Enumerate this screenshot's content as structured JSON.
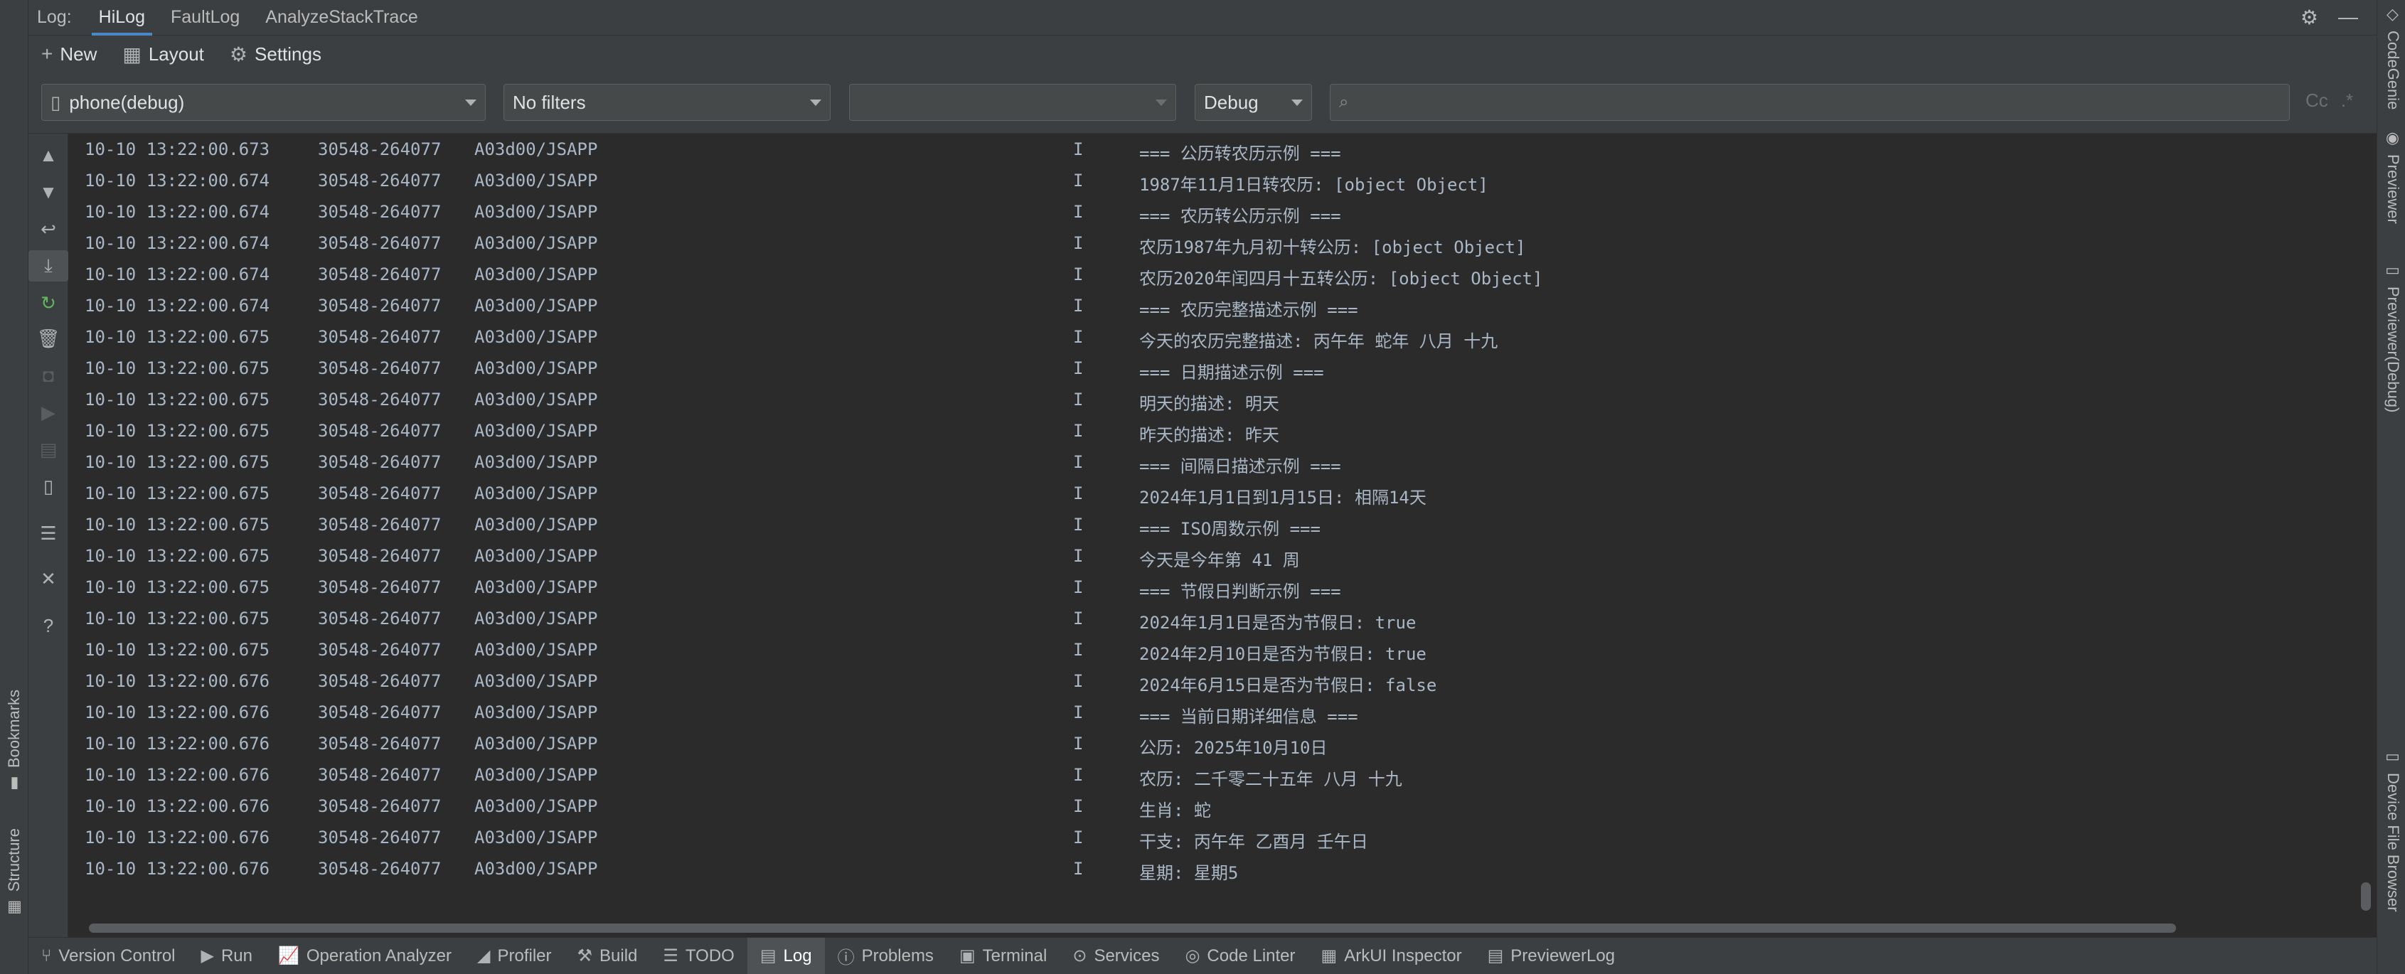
{
  "tabs": {
    "prefix": "Log:",
    "items": [
      "HiLog",
      "FaultLog",
      "AnalyzeStackTrace"
    ]
  },
  "toolbar": {
    "new_label": "New",
    "layout_label": "Layout",
    "settings_label": "Settings"
  },
  "filters": {
    "device": "phone(debug)",
    "filter": "No filters",
    "process": "",
    "level": "Debug",
    "search_value": "",
    "case_toggle": "Cc",
    "regex_toggle": ".*"
  },
  "right_stripe": [
    "CodeGenie",
    "Previewer",
    "Previewer(Debug)",
    "Device File Browser"
  ],
  "left_stripe": [
    "Bookmarks",
    "Structure"
  ],
  "log_rows": [
    {
      "time": "10-10 13:22:00.673",
      "pid": "30548-264077",
      "tag": "A03d00/JSAPP",
      "level": "I",
      "msg": "=== 公历转农历示例 ==="
    },
    {
      "time": "10-10 13:22:00.674",
      "pid": "30548-264077",
      "tag": "A03d00/JSAPP",
      "level": "I",
      "msg": "1987年11月1日转农历: [object Object]"
    },
    {
      "time": "10-10 13:22:00.674",
      "pid": "30548-264077",
      "tag": "A03d00/JSAPP",
      "level": "I",
      "msg": "=== 农历转公历示例 ==="
    },
    {
      "time": "10-10 13:22:00.674",
      "pid": "30548-264077",
      "tag": "A03d00/JSAPP",
      "level": "I",
      "msg": "农历1987年九月初十转公历: [object Object]"
    },
    {
      "time": "10-10 13:22:00.674",
      "pid": "30548-264077",
      "tag": "A03d00/JSAPP",
      "level": "I",
      "msg": "农历2020年闰四月十五转公历: [object Object]"
    },
    {
      "time": "10-10 13:22:00.674",
      "pid": "30548-264077",
      "tag": "A03d00/JSAPP",
      "level": "I",
      "msg": "=== 农历完整描述示例 ==="
    },
    {
      "time": "10-10 13:22:00.675",
      "pid": "30548-264077",
      "tag": "A03d00/JSAPP",
      "level": "I",
      "msg": "今天的农历完整描述: 丙午年 蛇年 八月 十九"
    },
    {
      "time": "10-10 13:22:00.675",
      "pid": "30548-264077",
      "tag": "A03d00/JSAPP",
      "level": "I",
      "msg": "=== 日期描述示例 ==="
    },
    {
      "time": "10-10 13:22:00.675",
      "pid": "30548-264077",
      "tag": "A03d00/JSAPP",
      "level": "I",
      "msg": "明天的描述: 明天"
    },
    {
      "time": "10-10 13:22:00.675",
      "pid": "30548-264077",
      "tag": "A03d00/JSAPP",
      "level": "I",
      "msg": "昨天的描述: 昨天"
    },
    {
      "time": "10-10 13:22:00.675",
      "pid": "30548-264077",
      "tag": "A03d00/JSAPP",
      "level": "I",
      "msg": "=== 间隔日描述示例 ==="
    },
    {
      "time": "10-10 13:22:00.675",
      "pid": "30548-264077",
      "tag": "A03d00/JSAPP",
      "level": "I",
      "msg": "2024年1月1日到1月15日: 相隔14天"
    },
    {
      "time": "10-10 13:22:00.675",
      "pid": "30548-264077",
      "tag": "A03d00/JSAPP",
      "level": "I",
      "msg": "=== ISO周数示例 ==="
    },
    {
      "time": "10-10 13:22:00.675",
      "pid": "30548-264077",
      "tag": "A03d00/JSAPP",
      "level": "I",
      "msg": "今天是今年第 41 周"
    },
    {
      "time": "10-10 13:22:00.675",
      "pid": "30548-264077",
      "tag": "A03d00/JSAPP",
      "level": "I",
      "msg": "=== 节假日判断示例 ==="
    },
    {
      "time": "10-10 13:22:00.675",
      "pid": "30548-264077",
      "tag": "A03d00/JSAPP",
      "level": "I",
      "msg": "2024年1月1日是否为节假日: true"
    },
    {
      "time": "10-10 13:22:00.675",
      "pid": "30548-264077",
      "tag": "A03d00/JSAPP",
      "level": "I",
      "msg": "2024年2月10日是否为节假日: true"
    },
    {
      "time": "10-10 13:22:00.676",
      "pid": "30548-264077",
      "tag": "A03d00/JSAPP",
      "level": "I",
      "msg": "2024年6月15日是否为节假日: false"
    },
    {
      "time": "10-10 13:22:00.676",
      "pid": "30548-264077",
      "tag": "A03d00/JSAPP",
      "level": "I",
      "msg": "=== 当前日期详细信息 ==="
    },
    {
      "time": "10-10 13:22:00.676",
      "pid": "30548-264077",
      "tag": "A03d00/JSAPP",
      "level": "I",
      "msg": "公历: 2025年10月10日"
    },
    {
      "time": "10-10 13:22:00.676",
      "pid": "30548-264077",
      "tag": "A03d00/JSAPP",
      "level": "I",
      "msg": "农历: 二千零二十五年 八月 十九"
    },
    {
      "time": "10-10 13:22:00.676",
      "pid": "30548-264077",
      "tag": "A03d00/JSAPP",
      "level": "I",
      "msg": "生肖: 蛇"
    },
    {
      "time": "10-10 13:22:00.676",
      "pid": "30548-264077",
      "tag": "A03d00/JSAPP",
      "level": "I",
      "msg": "干支: 丙午年 乙酉月 壬午日"
    },
    {
      "time": "10-10 13:22:00.676",
      "pid": "30548-264077",
      "tag": "A03d00/JSAPP",
      "level": "I",
      "msg": "星期: 星期5"
    }
  ],
  "bottom_bar": [
    {
      "label": "Version Control",
      "icon": "branch-icon",
      "active": false
    },
    {
      "label": "Run",
      "icon": "run-icon",
      "active": false
    },
    {
      "label": "Operation Analyzer",
      "icon": "chart-icon",
      "active": false
    },
    {
      "label": "Profiler",
      "icon": "profiler-icon",
      "active": false
    },
    {
      "label": "Build",
      "icon": "hammer-icon",
      "active": false
    },
    {
      "label": "TODO",
      "icon": "list-icon",
      "active": false
    },
    {
      "label": "Log",
      "icon": "log-icon",
      "active": true
    },
    {
      "label": "Problems",
      "icon": "info-icon",
      "active": false
    },
    {
      "label": "Terminal",
      "icon": "terminal-icon",
      "active": false
    },
    {
      "label": "Services",
      "icon": "services-icon",
      "active": false
    },
    {
      "label": "Code Linter",
      "icon": "linter-icon",
      "active": false
    },
    {
      "label": "ArkUI Inspector",
      "icon": "inspector-icon",
      "active": false
    },
    {
      "label": "PreviewerLog",
      "icon": "doc-icon",
      "active": false
    }
  ]
}
